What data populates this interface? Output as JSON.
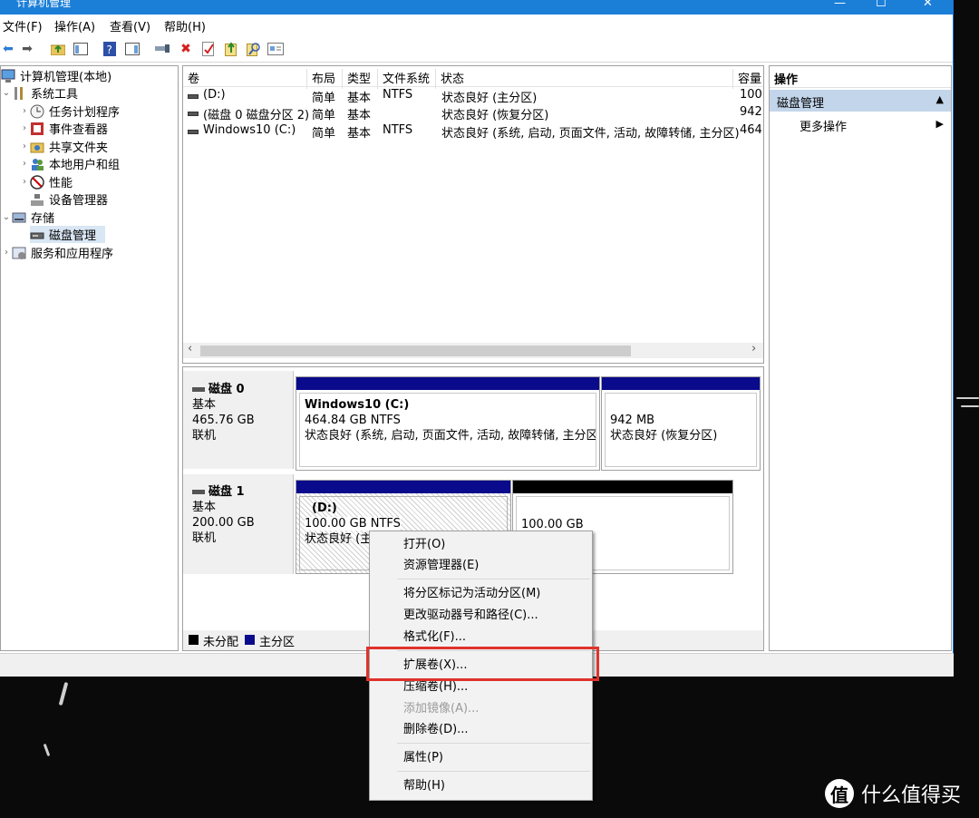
{
  "window": {
    "title": "计算机管理",
    "min_glyph": "—",
    "max_glyph": "☐",
    "close_glyph": "✕"
  },
  "menu": [
    "文件(F)",
    "操作(A)",
    "查看(V)",
    "帮助(H)"
  ],
  "toolbar_icons": [
    "back-arrow-icon",
    "forward-arrow-icon",
    "up-folder-icon",
    "show-hide-tree-icon",
    "help-icon",
    "show-hide-action-icon",
    "connect-icon",
    "delete-icon",
    "properties-icon",
    "export-icon",
    "search-icon",
    "details-icon"
  ],
  "tree": {
    "root": "计算机管理(本地)",
    "system_tools": "系统工具",
    "task_scheduler": "任务计划程序",
    "event_viewer": "事件查看器",
    "shared_folders": "共享文件夹",
    "local_users": "本地用户和组",
    "performance": "性能",
    "device_manager": "设备管理器",
    "storage": "存储",
    "disk_management": "磁盘管理",
    "services": "服务和应用程序"
  },
  "volume_list": {
    "columns": [
      "卷",
      "布局",
      "类型",
      "文件系统",
      "状态",
      "容量"
    ],
    "rows": [
      {
        "volume": "(D:)",
        "layout": "简单",
        "type": "基本",
        "fs": "NTFS",
        "status": "状态良好 (主分区)",
        "capacity": "100."
      },
      {
        "volume": "(磁盘 0 磁盘分区 2)",
        "layout": "简单",
        "type": "基本",
        "fs": "",
        "status": "状态良好 (恢复分区)",
        "capacity": "942"
      },
      {
        "volume": "Windows10 (C:)",
        "layout": "简单",
        "type": "基本",
        "fs": "NTFS",
        "status": "状态良好 (系统, 启动, 页面文件, 活动, 故障转储, 主分区)",
        "capacity": "464."
      }
    ],
    "scroll_left": "‹",
    "scroll_right": "›"
  },
  "disks": [
    {
      "name": "磁盘 0",
      "type": "基本",
      "size": "465.76 GB",
      "status": "联机",
      "partitions": [
        {
          "title": "Windows10  (C:)",
          "size": "464.84 GB NTFS",
          "status": "状态良好 (系统, 启动, 页面文件, 活动, 故障转储, 主分区)"
        },
        {
          "title": "",
          "size": "942 MB",
          "status": "状态良好 (恢复分区)"
        }
      ]
    },
    {
      "name": "磁盘 1",
      "type": "基本",
      "size": "200.00 GB",
      "status": "联机",
      "partitions": [
        {
          "title": "(D:)",
          "size": "100.00 GB NTFS",
          "status": "状态良好 (主"
        },
        {
          "title": "",
          "size": "100.00 GB",
          "status": ""
        }
      ]
    }
  ],
  "legend": {
    "unallocated": "未分配",
    "primary": "主分区"
  },
  "actions": {
    "header": "操作",
    "section": "磁盘管理",
    "more": "更多操作",
    "collapse_glyph": "▲",
    "more_glyph": "▶"
  },
  "context_menu": {
    "open": "打开(O)",
    "explorer": "资源管理器(E)",
    "mark_active": "将分区标记为活动分区(M)",
    "change_letter": "更改驱动器号和路径(C)...",
    "format": "格式化(F)...",
    "extend": "扩展卷(X)...",
    "shrink": "压缩卷(H)...",
    "add_mirror": "添加镜像(A)...",
    "delete": "删除卷(D)...",
    "properties": "属性(P)",
    "help": "帮助(H)"
  },
  "watermark": {
    "logo": "值",
    "text": "什么值得买"
  },
  "colors": {
    "primary_partition": "#0a0a8c",
    "unallocated": "#000000",
    "highlight": "#e0322b",
    "selection": "#d9e6f4",
    "action_section": "#c3d5ea"
  }
}
